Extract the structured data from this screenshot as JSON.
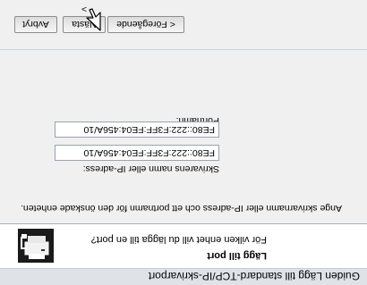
{
  "window": {
    "title": "Guiden Lägg till standard-TCP/IP-skrivarport"
  },
  "header": {
    "heading": "Lägg till port",
    "subheading": "För vilken enhet vill du lägga till en port?",
    "icon": "printer-port-icon"
  },
  "main": {
    "instruction": "Ange skrivarnamn eller IP-adress och ett portnamn för den önskade enheten.",
    "printer_field": {
      "label": "Skrivarens namn eller IP-adress:",
      "value": "FE80::222:F3FF:FE04:456A/10"
    },
    "port_field": {
      "label": "Portnamn:",
      "value": "FE80::222:F3FF:FE04:456A/10"
    }
  },
  "footer": {
    "back_label": "< Föregående",
    "next_label": "Nästa >",
    "cancel_label": "Avbryt"
  },
  "colors": {
    "header_bg": "#ffffff",
    "body_bg": "#f0f0f0",
    "title_bg": "#dfe3e8"
  }
}
